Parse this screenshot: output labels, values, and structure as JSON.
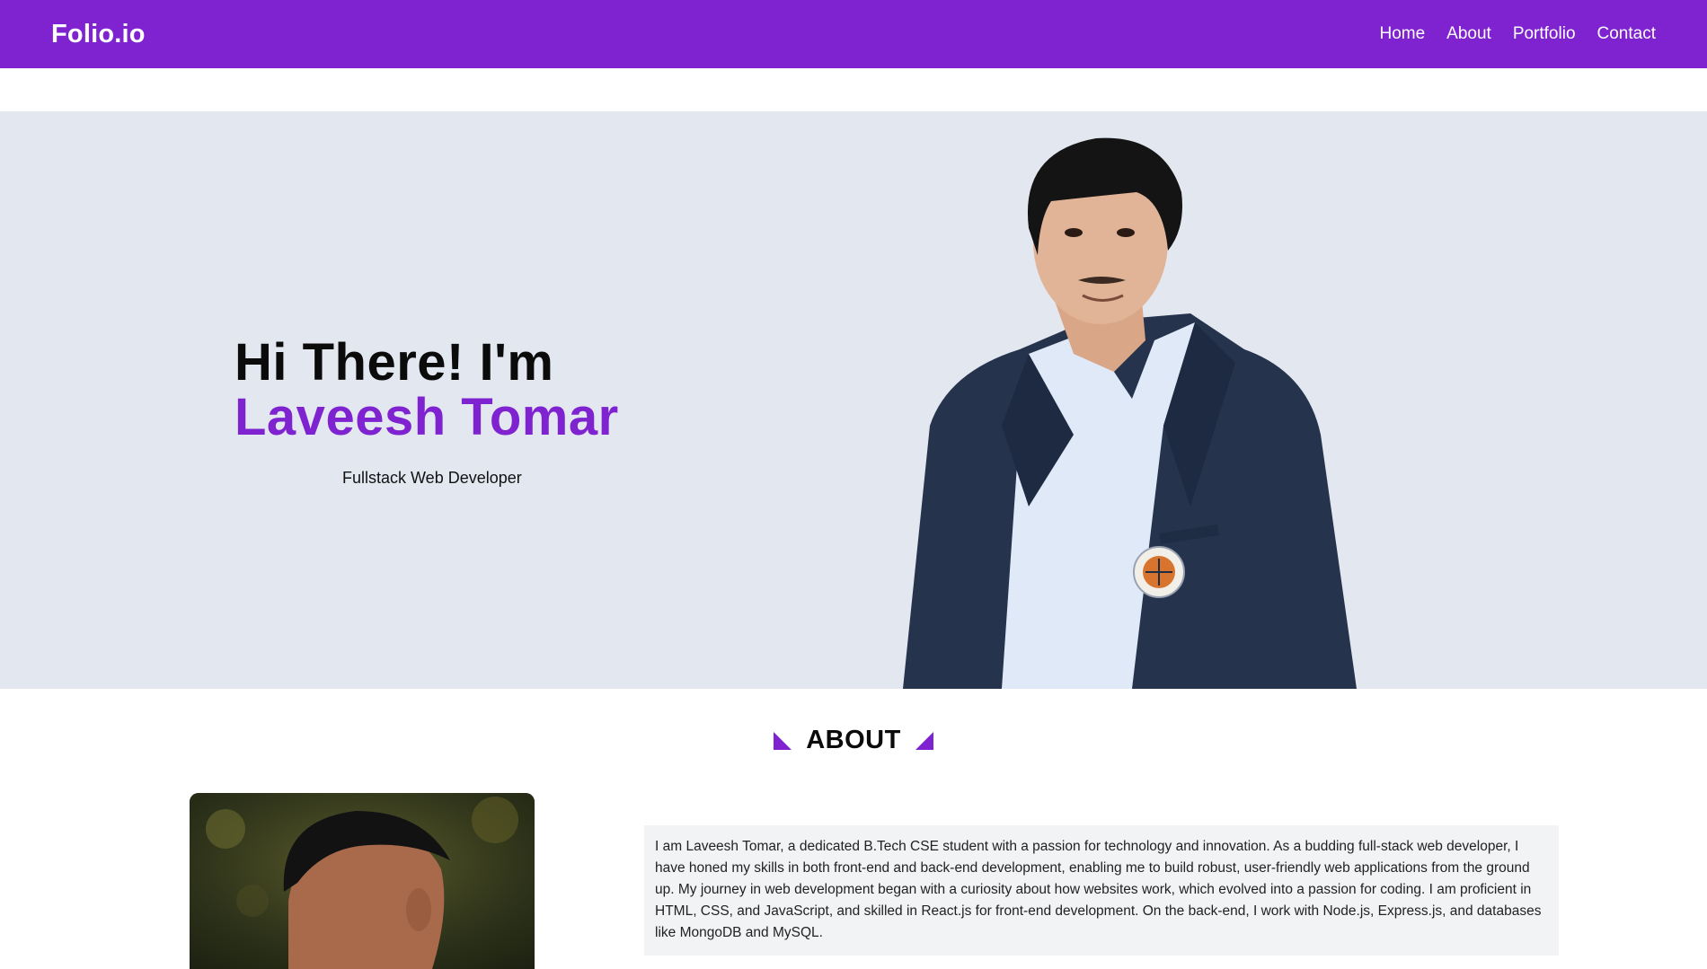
{
  "brand": "Folio.io",
  "nav": {
    "items": [
      {
        "label": "Home"
      },
      {
        "label": "About"
      },
      {
        "label": "Portfolio"
      },
      {
        "label": "Contact"
      }
    ]
  },
  "hero": {
    "greeting": "Hi There! I'm",
    "name": "Laveesh Tomar",
    "role": "Fullstack Web Developer"
  },
  "about": {
    "title": "ABOUT",
    "text": "I am Laveesh Tomar, a dedicated B.Tech CSE student with a passion for technology and innovation. As a budding full-stack web developer, I have honed my skills in both front-end and back-end development, enabling me to build robust, user-friendly web applications from the ground up. My journey in web development began with a curiosity about how websites work, which evolved into a passion for coding. I am proficient in HTML, CSS, and JavaScript, and skilled in React.js for front-end development. On the back-end, I work with Node.js, Express.js, and databases like MongoDB and MySQL."
  },
  "colors": {
    "accent": "#7f22d0",
    "hero_bg": "#e2e7f0",
    "text_bg": "#f2f3f5"
  }
}
